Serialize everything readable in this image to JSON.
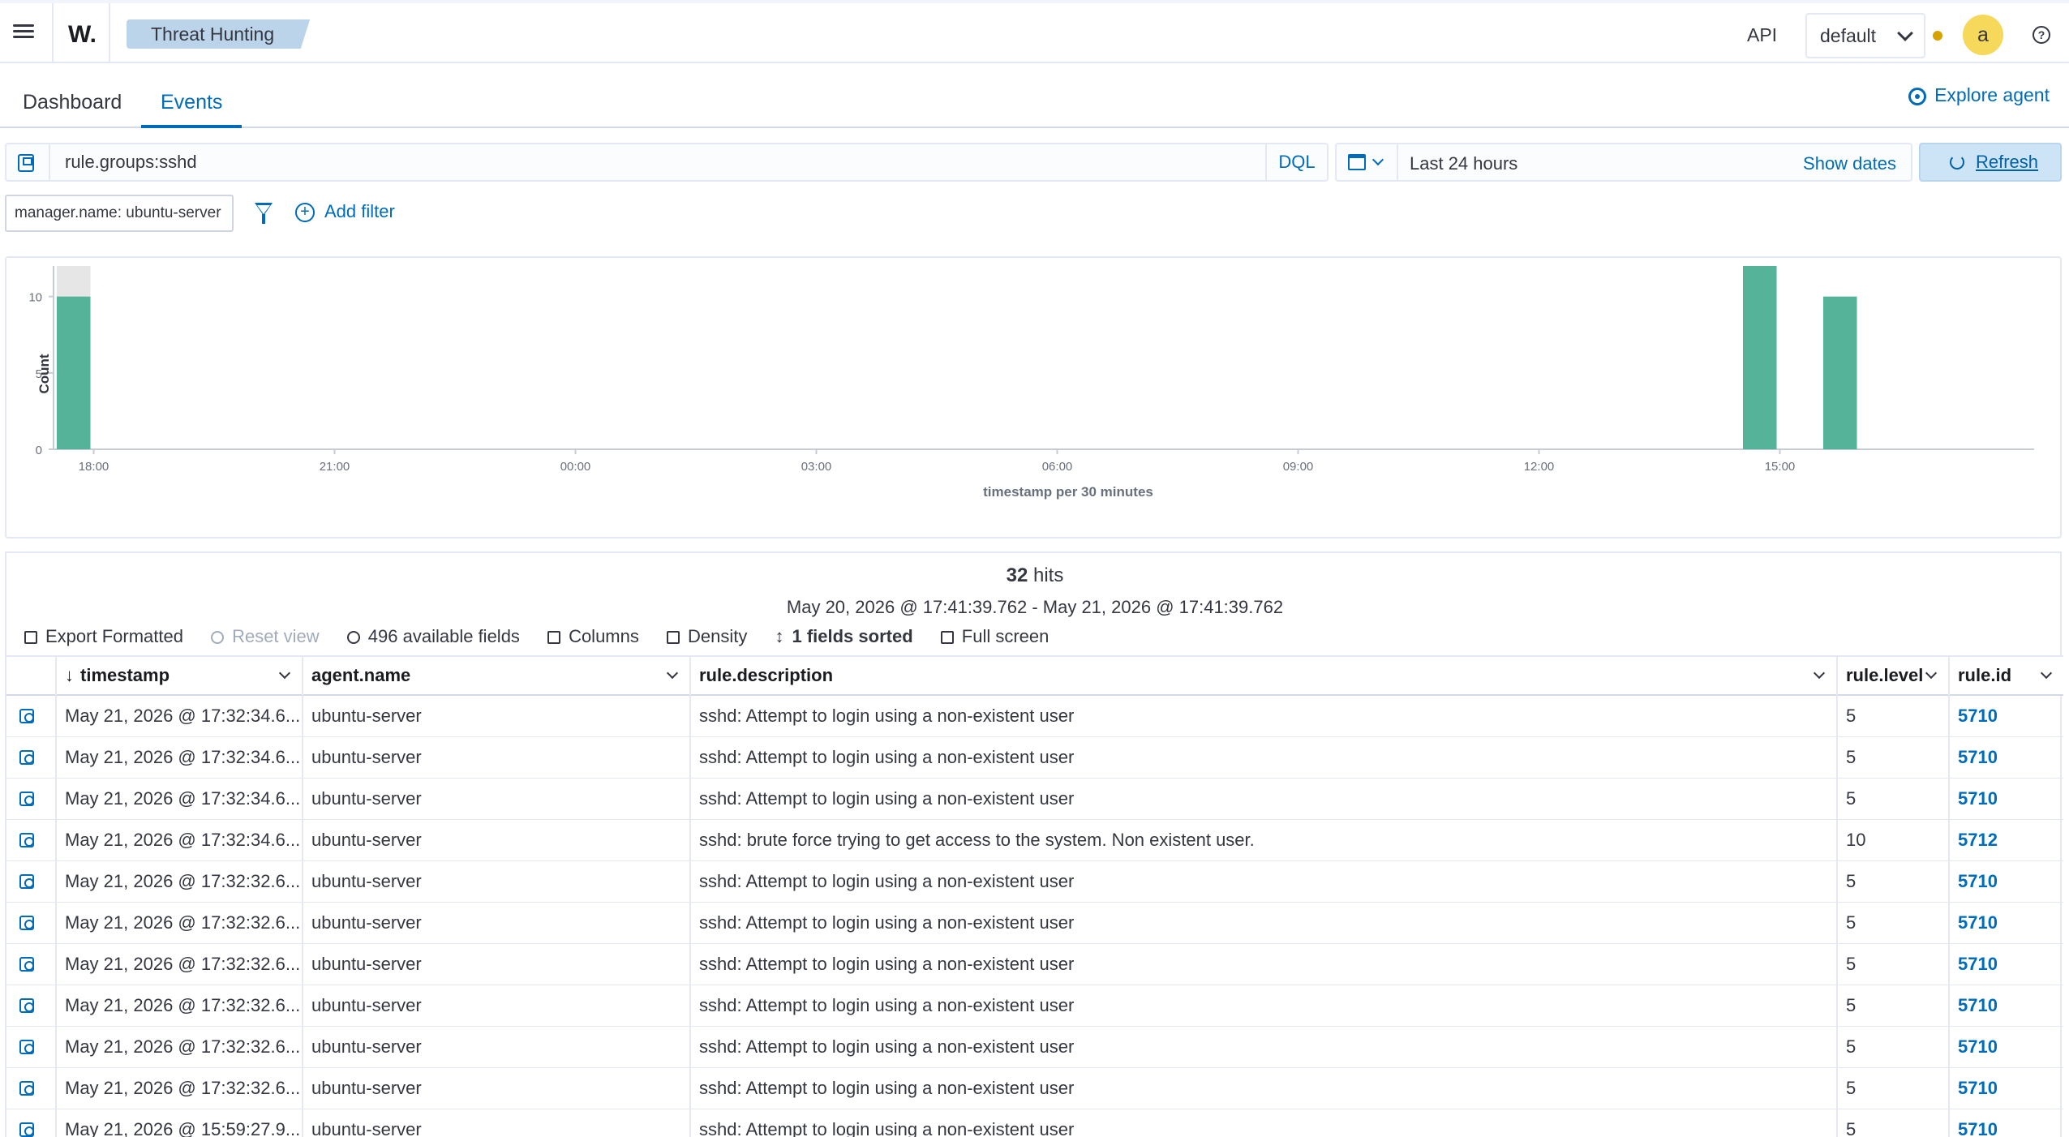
{
  "header": {
    "logo": "W.",
    "breadcrumb": "Threat Hunting",
    "api_label": "API",
    "space": "default",
    "avatar_letter": "a",
    "help_glyph": "?"
  },
  "tabs": [
    {
      "label": "Dashboard",
      "active": false
    },
    {
      "label": "Events",
      "active": true
    }
  ],
  "explore_agent": "Explore agent",
  "query": {
    "value": "rule.groups:sshd",
    "language": "DQL"
  },
  "date_picker": {
    "range": "Last 24 hours",
    "show_dates": "Show dates",
    "refresh": "Refresh"
  },
  "filters": {
    "pill": "manager.name: ubuntu-server",
    "add_filter": "Add filter"
  },
  "chart_data": {
    "type": "bar",
    "title": "",
    "xlabel": "timestamp per 30 minutes",
    "ylabel": "Count",
    "x_ticks": [
      "18:00",
      "21:00",
      "00:00",
      "03:00",
      "06:00",
      "09:00",
      "12:00",
      "15:00"
    ],
    "y_ticks": [
      0,
      5,
      10
    ],
    "ylim": [
      0,
      12
    ],
    "bar_interval": "30 minutes",
    "series": [
      {
        "values": [
          {
            "x": "14:30",
            "y": 12
          },
          {
            "x": "15:30",
            "y": 10
          },
          {
            "x": "17:30",
            "y": 10
          }
        ],
        "color": "#54b399"
      }
    ],
    "partial_bucket": {
      "x": "17:30",
      "y": 12,
      "color": "#e6e6e6"
    }
  },
  "results": {
    "hits_count": "32",
    "hits_label": "hits",
    "range_text": "May 20, 2026 @ 17:41:39.762 - May 21, 2026 @ 17:41:39.762",
    "toolbar": {
      "export": "Export Formatted",
      "reset": "Reset view",
      "fields": "496 available fields",
      "columns": "Columns",
      "density": "Density",
      "sorted": "1 fields sorted",
      "fullscreen": "Full screen"
    },
    "columns": [
      "timestamp",
      "agent.name",
      "rule.description",
      "rule.level",
      "rule.id"
    ],
    "rows": [
      {
        "timestamp": "May 21, 2026 @ 17:32:34.6...",
        "agent": "ubuntu-server",
        "description": "sshd: Attempt to login using a non-existent user",
        "level": "5",
        "id": "5710"
      },
      {
        "timestamp": "May 21, 2026 @ 17:32:34.6...",
        "agent": "ubuntu-server",
        "description": "sshd: Attempt to login using a non-existent user",
        "level": "5",
        "id": "5710"
      },
      {
        "timestamp": "May 21, 2026 @ 17:32:34.6...",
        "agent": "ubuntu-server",
        "description": "sshd: Attempt to login using a non-existent user",
        "level": "5",
        "id": "5710"
      },
      {
        "timestamp": "May 21, 2026 @ 17:32:34.6...",
        "agent": "ubuntu-server",
        "description": "sshd: brute force trying to get access to the system. Non existent user.",
        "level": "10",
        "id": "5712"
      },
      {
        "timestamp": "May 21, 2026 @ 17:32:32.6...",
        "agent": "ubuntu-server",
        "description": "sshd: Attempt to login using a non-existent user",
        "level": "5",
        "id": "5710"
      },
      {
        "timestamp": "May 21, 2026 @ 17:32:32.6...",
        "agent": "ubuntu-server",
        "description": "sshd: Attempt to login using a non-existent user",
        "level": "5",
        "id": "5710"
      },
      {
        "timestamp": "May 21, 2026 @ 17:32:32.6...",
        "agent": "ubuntu-server",
        "description": "sshd: Attempt to login using a non-existent user",
        "level": "5",
        "id": "5710"
      },
      {
        "timestamp": "May 21, 2026 @ 17:32:32.6...",
        "agent": "ubuntu-server",
        "description": "sshd: Attempt to login using a non-existent user",
        "level": "5",
        "id": "5710"
      },
      {
        "timestamp": "May 21, 2026 @ 17:32:32.6...",
        "agent": "ubuntu-server",
        "description": "sshd: Attempt to login using a non-existent user",
        "level": "5",
        "id": "5710"
      },
      {
        "timestamp": "May 21, 2026 @ 17:32:32.6...",
        "agent": "ubuntu-server",
        "description": "sshd: Attempt to login using a non-existent user",
        "level": "5",
        "id": "5710"
      },
      {
        "timestamp": "May 21, 2026 @ 15:59:27.9...",
        "agent": "ubuntu-server",
        "description": "sshd: Attempt to login using a non-existent user",
        "level": "5",
        "id": "5710"
      }
    ]
  }
}
